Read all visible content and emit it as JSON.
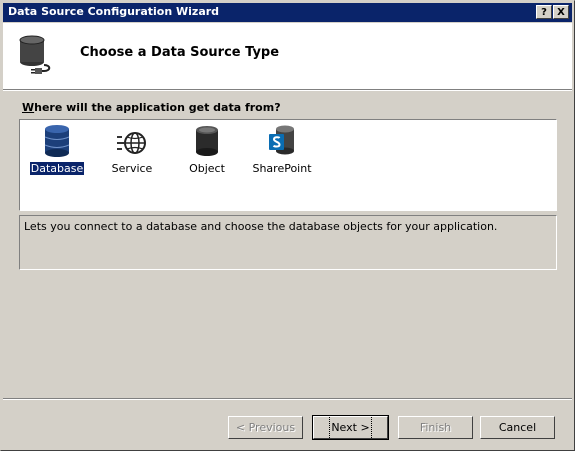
{
  "window": {
    "title": "Data Source Configuration Wizard",
    "help_glyph": "?",
    "close_glyph": "X"
  },
  "header": {
    "title": "Choose a Data Source Type",
    "icon": "database-plug-icon"
  },
  "question": {
    "label": "Where will the application get data from?",
    "mnemonic": "W"
  },
  "options": [
    {
      "label": "Database",
      "icon": "database-icon",
      "selected": true
    },
    {
      "label": "Service",
      "icon": "service-globe-icon",
      "selected": false
    },
    {
      "label": "Object",
      "icon": "object-cylinder-icon",
      "selected": false
    },
    {
      "label": "SharePoint",
      "icon": "sharepoint-icon",
      "selected": false
    }
  ],
  "description": "Lets you connect to a database and choose the database objects for your application.",
  "buttons": {
    "previous": {
      "label": "< Previous",
      "enabled": false
    },
    "next": {
      "label": "Next >",
      "enabled": true
    },
    "finish": {
      "label": "Finish",
      "enabled": false
    },
    "cancel": {
      "label": "Cancel",
      "enabled": true
    }
  },
  "colors": {
    "titlebar": "#0a246a",
    "face": "#d4d0c8",
    "selection": "#0a246a"
  }
}
